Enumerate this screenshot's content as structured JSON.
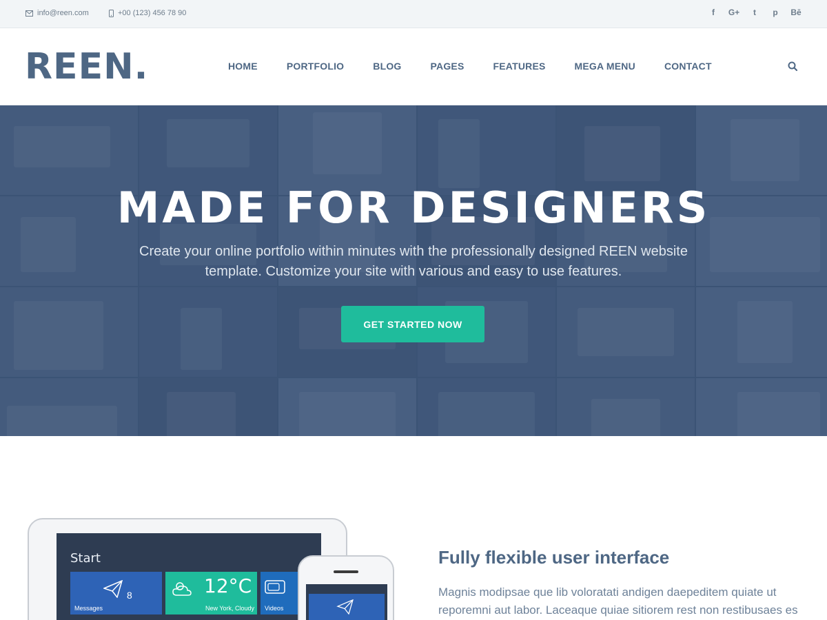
{
  "topbar": {
    "email": "info@reen.com",
    "phone": "+00 (123) 456 78 90",
    "social": [
      {
        "icon": "facebook-icon",
        "glyph": "f"
      },
      {
        "icon": "google-plus-icon",
        "glyph": "G+"
      },
      {
        "icon": "twitter-icon",
        "glyph": "t"
      },
      {
        "icon": "pinterest-icon",
        "glyph": "p"
      },
      {
        "icon": "behance-icon",
        "glyph": "Bē"
      }
    ]
  },
  "header": {
    "logo": "REEN.",
    "nav": [
      "HOME",
      "PORTFOLIO",
      "BLOG",
      "PAGES",
      "FEATURES",
      "MEGA MENU",
      "CONTACT"
    ]
  },
  "hero": {
    "title": "MADE FOR DESIGNERS",
    "text": "Create your online portfolio within minutes with the professionally designed REEN website template. Customize your site with various and easy to use features.",
    "cta": "GET STARTED NOW"
  },
  "devices": {
    "start": "Start",
    "tiles": {
      "messages": "Messages",
      "messages_count": "8",
      "weather_temp": "12°C",
      "weather_loc": "New York, Cloudy",
      "videos": "Videos"
    }
  },
  "feature": {
    "title": "Fully flexible user interface",
    "text": "Magnis modipsae que lib voloratati andigen daepeditem quiate ut reporemni aut labor. Laceaque quiae sitiorem rest non restibusaes es"
  },
  "colors": {
    "brand": "#4e6784",
    "accent": "#1fbc9c",
    "topbar_bg": "#f2f5f7"
  }
}
